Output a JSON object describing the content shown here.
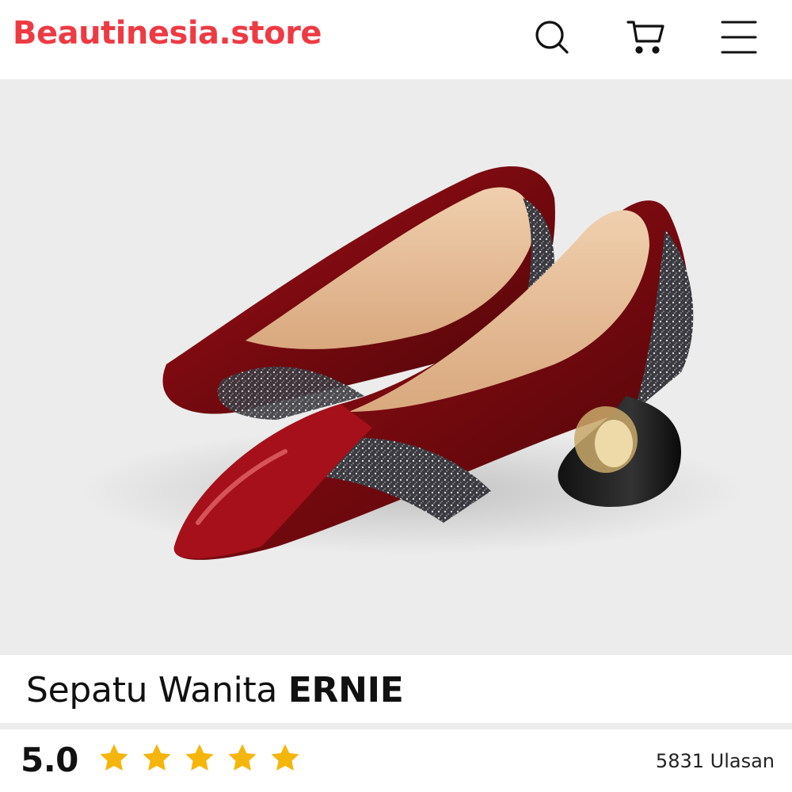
{
  "header": {
    "brand": "Beautinesia.store",
    "brand_color": "#ee3a43",
    "icons": [
      "search-icon",
      "cart-icon",
      "menu-icon"
    ]
  },
  "hero": {
    "image": "red-patent-glitter-pumps-image",
    "background": "#ececec"
  },
  "product": {
    "title_prefix": "Sepatu Wanita ",
    "title_name": "ERNIE"
  },
  "rating": {
    "value": "5.0",
    "stars": 5,
    "star_color": "#f5b60c",
    "reviews_label": "5831 Ulasan"
  }
}
